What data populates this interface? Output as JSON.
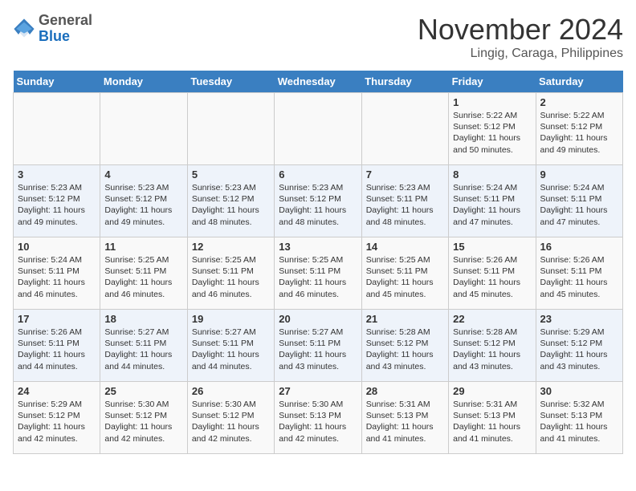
{
  "header": {
    "logo_line1": "General",
    "logo_line2": "Blue",
    "month_title": "November 2024",
    "location": "Lingig, Caraga, Philippines"
  },
  "weekdays": [
    "Sunday",
    "Monday",
    "Tuesday",
    "Wednesday",
    "Thursday",
    "Friday",
    "Saturday"
  ],
  "weeks": [
    [
      {
        "day": "",
        "info": ""
      },
      {
        "day": "",
        "info": ""
      },
      {
        "day": "",
        "info": ""
      },
      {
        "day": "",
        "info": ""
      },
      {
        "day": "",
        "info": ""
      },
      {
        "day": "1",
        "info": "Sunrise: 5:22 AM\nSunset: 5:12 PM\nDaylight: 11 hours\nand 50 minutes."
      },
      {
        "day": "2",
        "info": "Sunrise: 5:22 AM\nSunset: 5:12 PM\nDaylight: 11 hours\nand 49 minutes."
      }
    ],
    [
      {
        "day": "3",
        "info": "Sunrise: 5:23 AM\nSunset: 5:12 PM\nDaylight: 11 hours\nand 49 minutes."
      },
      {
        "day": "4",
        "info": "Sunrise: 5:23 AM\nSunset: 5:12 PM\nDaylight: 11 hours\nand 49 minutes."
      },
      {
        "day": "5",
        "info": "Sunrise: 5:23 AM\nSunset: 5:12 PM\nDaylight: 11 hours\nand 48 minutes."
      },
      {
        "day": "6",
        "info": "Sunrise: 5:23 AM\nSunset: 5:12 PM\nDaylight: 11 hours\nand 48 minutes."
      },
      {
        "day": "7",
        "info": "Sunrise: 5:23 AM\nSunset: 5:11 PM\nDaylight: 11 hours\nand 48 minutes."
      },
      {
        "day": "8",
        "info": "Sunrise: 5:24 AM\nSunset: 5:11 PM\nDaylight: 11 hours\nand 47 minutes."
      },
      {
        "day": "9",
        "info": "Sunrise: 5:24 AM\nSunset: 5:11 PM\nDaylight: 11 hours\nand 47 minutes."
      }
    ],
    [
      {
        "day": "10",
        "info": "Sunrise: 5:24 AM\nSunset: 5:11 PM\nDaylight: 11 hours\nand 46 minutes."
      },
      {
        "day": "11",
        "info": "Sunrise: 5:25 AM\nSunset: 5:11 PM\nDaylight: 11 hours\nand 46 minutes."
      },
      {
        "day": "12",
        "info": "Sunrise: 5:25 AM\nSunset: 5:11 PM\nDaylight: 11 hours\nand 46 minutes."
      },
      {
        "day": "13",
        "info": "Sunrise: 5:25 AM\nSunset: 5:11 PM\nDaylight: 11 hours\nand 46 minutes."
      },
      {
        "day": "14",
        "info": "Sunrise: 5:25 AM\nSunset: 5:11 PM\nDaylight: 11 hours\nand 45 minutes."
      },
      {
        "day": "15",
        "info": "Sunrise: 5:26 AM\nSunset: 5:11 PM\nDaylight: 11 hours\nand 45 minutes."
      },
      {
        "day": "16",
        "info": "Sunrise: 5:26 AM\nSunset: 5:11 PM\nDaylight: 11 hours\nand 45 minutes."
      }
    ],
    [
      {
        "day": "17",
        "info": "Sunrise: 5:26 AM\nSunset: 5:11 PM\nDaylight: 11 hours\nand 44 minutes."
      },
      {
        "day": "18",
        "info": "Sunrise: 5:27 AM\nSunset: 5:11 PM\nDaylight: 11 hours\nand 44 minutes."
      },
      {
        "day": "19",
        "info": "Sunrise: 5:27 AM\nSunset: 5:11 PM\nDaylight: 11 hours\nand 44 minutes."
      },
      {
        "day": "20",
        "info": "Sunrise: 5:27 AM\nSunset: 5:11 PM\nDaylight: 11 hours\nand 43 minutes."
      },
      {
        "day": "21",
        "info": "Sunrise: 5:28 AM\nSunset: 5:12 PM\nDaylight: 11 hours\nand 43 minutes."
      },
      {
        "day": "22",
        "info": "Sunrise: 5:28 AM\nSunset: 5:12 PM\nDaylight: 11 hours\nand 43 minutes."
      },
      {
        "day": "23",
        "info": "Sunrise: 5:29 AM\nSunset: 5:12 PM\nDaylight: 11 hours\nand 43 minutes."
      }
    ],
    [
      {
        "day": "24",
        "info": "Sunrise: 5:29 AM\nSunset: 5:12 PM\nDaylight: 11 hours\nand 42 minutes."
      },
      {
        "day": "25",
        "info": "Sunrise: 5:30 AM\nSunset: 5:12 PM\nDaylight: 11 hours\nand 42 minutes."
      },
      {
        "day": "26",
        "info": "Sunrise: 5:30 AM\nSunset: 5:12 PM\nDaylight: 11 hours\nand 42 minutes."
      },
      {
        "day": "27",
        "info": "Sunrise: 5:30 AM\nSunset: 5:13 PM\nDaylight: 11 hours\nand 42 minutes."
      },
      {
        "day": "28",
        "info": "Sunrise: 5:31 AM\nSunset: 5:13 PM\nDaylight: 11 hours\nand 41 minutes."
      },
      {
        "day": "29",
        "info": "Sunrise: 5:31 AM\nSunset: 5:13 PM\nDaylight: 11 hours\nand 41 minutes."
      },
      {
        "day": "30",
        "info": "Sunrise: 5:32 AM\nSunset: 5:13 PM\nDaylight: 11 hours\nand 41 minutes."
      }
    ]
  ]
}
